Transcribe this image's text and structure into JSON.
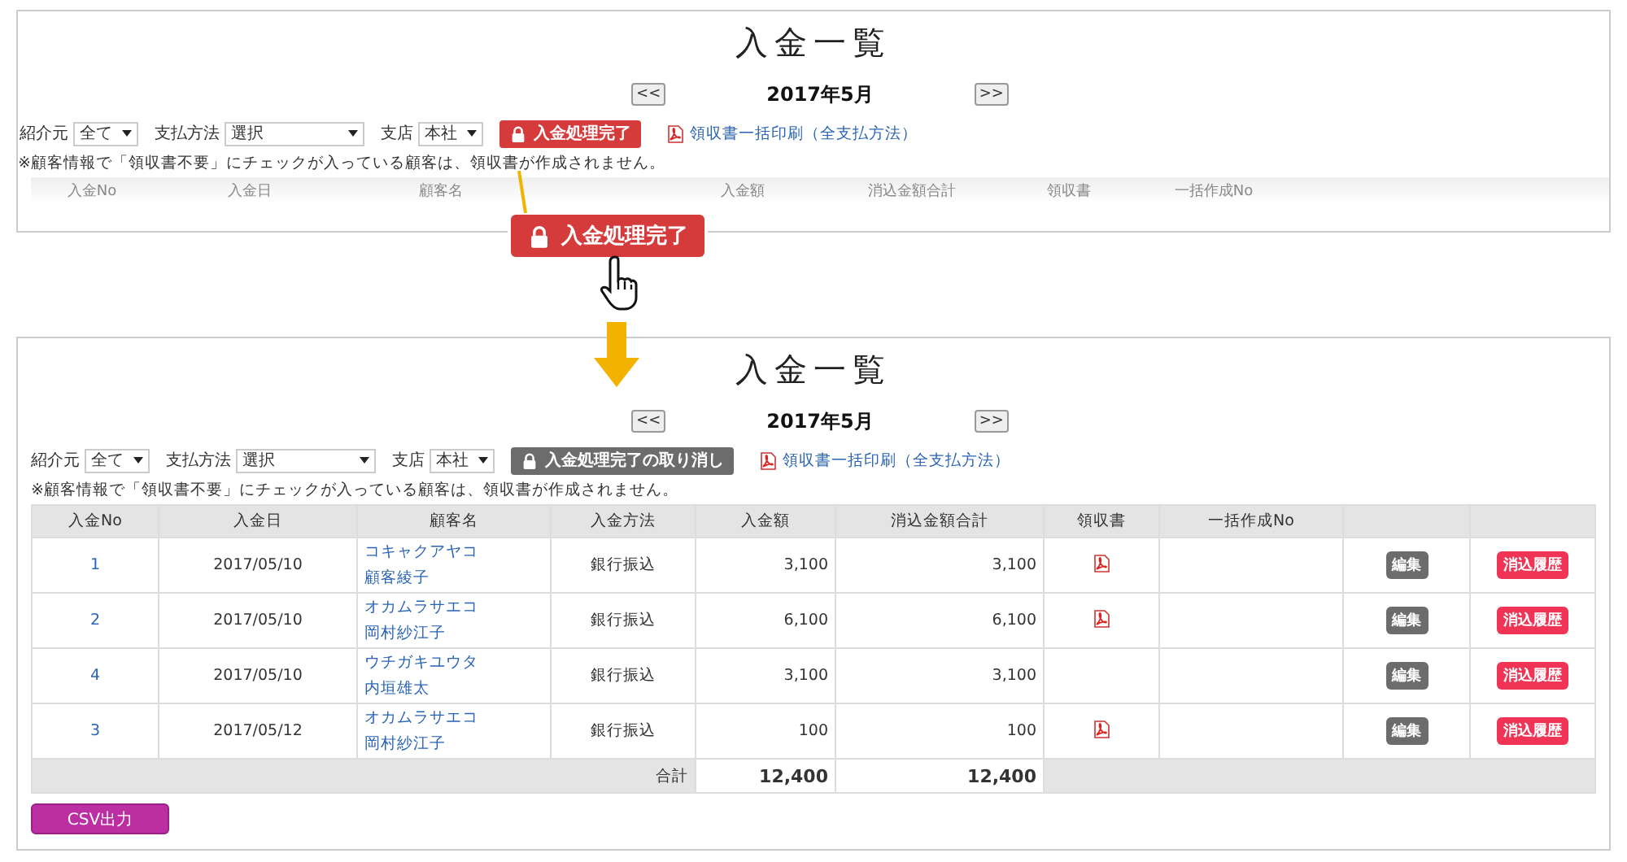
{
  "before": {
    "title": "入金一覧",
    "nav": {
      "prev": "<<",
      "month": "2017年5月",
      "next": ">>"
    },
    "filters": [
      {
        "label": "紹介元",
        "value": "全て"
      },
      {
        "label": "支払方法",
        "value": "選択"
      },
      {
        "label": "支店",
        "value": "本社"
      }
    ],
    "action_button": {
      "kind": "complete",
      "label": "入金処理完了"
    },
    "print_link": "領収書一括印刷（全支払方法）",
    "note": "※顧客情報で「領収書不要」にチェックが入っている顧客は、領収書が作成されません。",
    "columns": [
      {
        "kind": "label",
        "label": "入金No"
      },
      {
        "kind": "label",
        "label": "入金日"
      },
      {
        "kind": "label",
        "label": "顧客名"
      },
      {
        "kind": "covered"
      },
      {
        "kind": "label",
        "label": "入金額"
      },
      {
        "kind": "label",
        "label": "消込金額合計"
      },
      {
        "kind": "label",
        "label": "領収書"
      },
      {
        "kind": "label",
        "label": "一括作成No"
      }
    ]
  },
  "callout": {
    "kind": "complete",
    "label": "入金処理完了"
  },
  "after": {
    "title": "入金一覧",
    "nav": {
      "prev": "<<",
      "month": "2017年5月",
      "next": ">>"
    },
    "filters": [
      {
        "label": "紹介元",
        "value": "全て"
      },
      {
        "label": "支払方法",
        "value": "選択"
      },
      {
        "label": "支店",
        "value": "本社"
      }
    ],
    "action_button": {
      "kind": "cancel",
      "label": "入金処理完了の取り消し"
    },
    "print_link": "領収書一括印刷（全支払方法）",
    "note": "※顧客情報で「領収書不要」にチェックが入っている顧客は、領収書が作成されません。",
    "table": {
      "columns": [
        "入金No",
        "入金日",
        "顧客名",
        "入金方法",
        "入金額",
        "消込金額合計",
        "領収書",
        "一括作成No"
      ],
      "rows": [
        {
          "no": "1",
          "date": "2017/05/10",
          "kana": "コキャクアヤコ",
          "name": "顧客綾子",
          "method": "銀行振込",
          "amount": "3,100",
          "cleared": "3,100",
          "receipt": true,
          "edit": "編集",
          "history": "消込履歴"
        },
        {
          "no": "2",
          "date": "2017/05/10",
          "kana": "オカムラサエコ",
          "name": "岡村紗江子",
          "method": "銀行振込",
          "amount": "6,100",
          "cleared": "6,100",
          "receipt": true,
          "edit": "編集",
          "history": "消込履歴"
        },
        {
          "no": "4",
          "date": "2017/05/10",
          "kana": "ウチガキユウタ",
          "name": "内垣雄太",
          "method": "銀行振込",
          "amount": "3,100",
          "cleared": "3,100",
          "receipt": false,
          "edit": "編集",
          "history": "消込履歴"
        },
        {
          "no": "3",
          "date": "2017/05/12",
          "kana": "オカムラサエコ",
          "name": "岡村紗江子",
          "method": "銀行振込",
          "amount": "100",
          "cleared": "100",
          "receipt": true,
          "edit": "編集",
          "history": "消込履歴"
        }
      ],
      "total": {
        "label": "合計",
        "amount": "12,400",
        "cleared": "12,400"
      }
    },
    "csv_button": "CSV出力"
  }
}
